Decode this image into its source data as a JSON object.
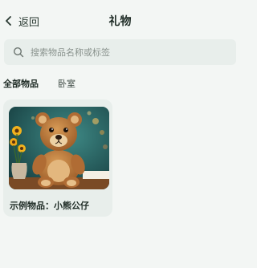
{
  "header": {
    "back_label": "返回",
    "title": "礼物"
  },
  "search": {
    "placeholder": "搜索物品名称或标签",
    "value": ""
  },
  "tabs": [
    {
      "label": "全部物品",
      "active": true
    },
    {
      "label": "卧室",
      "active": false
    }
  ],
  "items": [
    {
      "name": "示例物品：小熊公仔",
      "image_icon": "teddy-bear-photo"
    }
  ],
  "colors": {
    "background": "#f3f6f4",
    "card": "#e8eeeb",
    "text": "#1d2a24"
  }
}
